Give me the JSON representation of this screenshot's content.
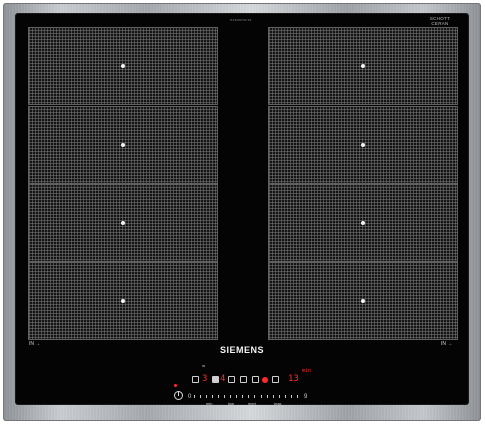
{
  "brand": "SIEMENS",
  "model_code": "EX645FXC1E",
  "schott": {
    "line1": "SCHOTT",
    "line2": "CERAN"
  },
  "flex_left": "IN  →",
  "flex_right": "IN  →",
  "zones": {
    "left": [
      "zone-1",
      "zone-2",
      "zone-3",
      "zone-4"
    ],
    "right": [
      "zone-5",
      "zone-6",
      "zone-7",
      "zone-8"
    ]
  },
  "control_panel": {
    "power_symbol": "I",
    "zone_left_display": "3",
    "zone_mid_display": "4",
    "timer_display": "13",
    "timer_label": "min",
    "slider_start": "0",
    "slider_end": "9",
    "slider_labels": [
      "min",
      "low",
      "med",
      "max"
    ],
    "fry_symbol": "≈"
  },
  "colors": {
    "glass": "#040404",
    "frame": "#b5b9bd",
    "display_red": "#ff2a2a",
    "grid": "#6a6a6a"
  }
}
